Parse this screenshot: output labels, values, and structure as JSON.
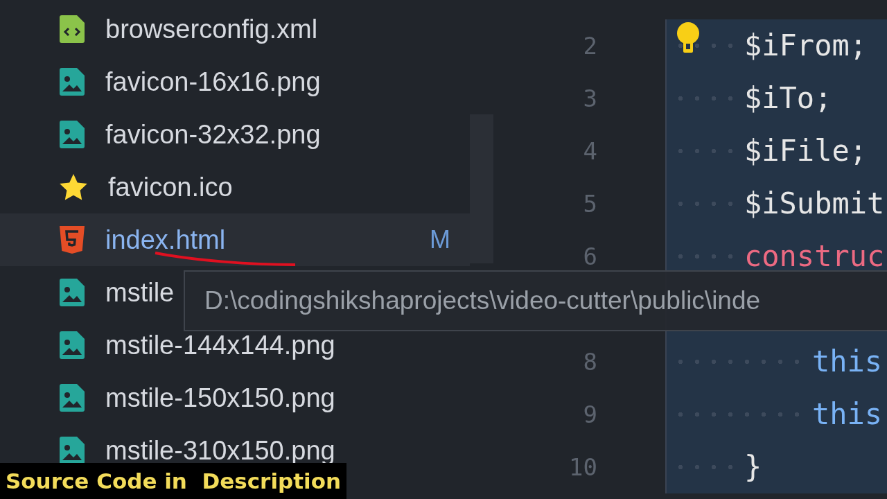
{
  "explorer": {
    "files": [
      {
        "name": "browserconfig.xml",
        "kind": "xml",
        "selected": false
      },
      {
        "name": "favicon-16x16.png",
        "kind": "image",
        "selected": false
      },
      {
        "name": "favicon-32x32.png",
        "kind": "image",
        "selected": false
      },
      {
        "name": "favicon.ico",
        "kind": "star",
        "selected": false
      },
      {
        "name": "index.html",
        "kind": "html",
        "selected": true,
        "status": "M",
        "underlined": true
      },
      {
        "name": "mstile",
        "kind": "image",
        "selected": false
      },
      {
        "name": "mstile-144x144.png",
        "kind": "image",
        "selected": false
      },
      {
        "name": "mstile-150x150.png",
        "kind": "image",
        "selected": false
      },
      {
        "name": "mstile-310x150.png",
        "kind": "image",
        "selected": false
      }
    ]
  },
  "editor": {
    "lines": [
      {
        "number": "2",
        "lightbulb": true,
        "tokens": [
          {
            "text": "$iFrom;",
            "kind": "plain"
          }
        ]
      },
      {
        "number": "3",
        "tokens": [
          {
            "text": "$iTo;",
            "kind": "plain"
          }
        ]
      },
      {
        "number": "4",
        "tokens": [
          {
            "text": "$iFile;",
            "kind": "plain"
          }
        ]
      },
      {
        "number": "5",
        "tokens": [
          {
            "text": "$iSubmit",
            "kind": "plain"
          }
        ]
      },
      {
        "number": "6",
        "tokens": [
          {
            "text": "construc",
            "kind": "keyword"
          }
        ],
        "children": [
          {
            "number": "8",
            "tokens": [
              {
                "text": "this",
                "kind": "this"
              }
            ]
          },
          {
            "number": "9",
            "tokens": [
              {
                "text": "this",
                "kind": "this"
              }
            ]
          }
        ]
      },
      {
        "number": "10",
        "tokens": [
          {
            "text": "}",
            "kind": "plain"
          }
        ]
      }
    ]
  },
  "tooltip": {
    "text": "D:\\codingshikshaprojects\\video-cutter\\public\\inde"
  },
  "caption": "Source Code in  Description"
}
